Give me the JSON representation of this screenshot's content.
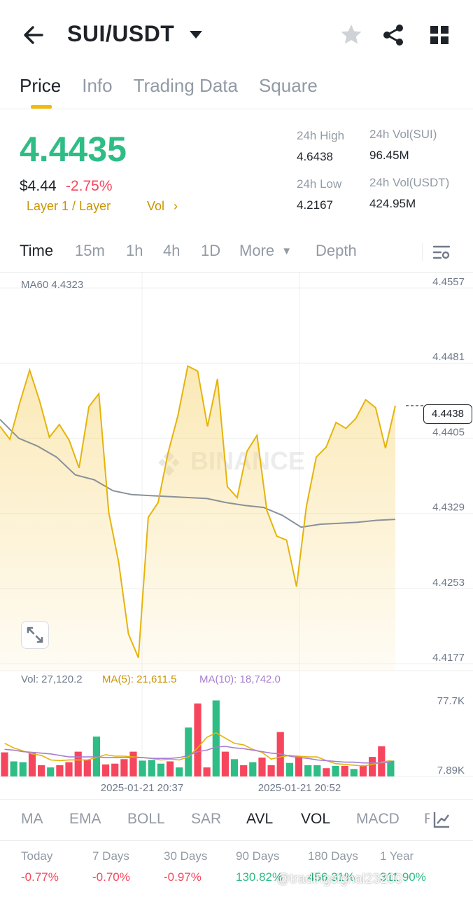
{
  "header": {
    "pair": "SUI/USDT"
  },
  "tabs": [
    {
      "label": "Price",
      "active": true
    },
    {
      "label": "Info",
      "active": false
    },
    {
      "label": "Trading Data",
      "active": false
    },
    {
      "label": "Square",
      "active": false
    }
  ],
  "ticker": {
    "last_price": "4.4435",
    "usd_price": "$4.44",
    "change_pct": "-2.75%",
    "tags": "Layer 1 / Layer",
    "vol_link": "Vol",
    "high_label": "24h High",
    "high_value": "4.6438",
    "low_label": "24h Low",
    "low_value": "4.2167",
    "vol_base_label": "24h Vol(SUI)",
    "vol_base_value": "96.45M",
    "vol_quote_label": "24h Vol(USDT)",
    "vol_quote_value": "424.95M"
  },
  "intervals": {
    "items": [
      "Time",
      "15m",
      "1h",
      "4h",
      "1D",
      "More"
    ],
    "active": "Time",
    "depth": "Depth"
  },
  "chart_data": {
    "type": "line",
    "price_ma_label": "MA60 4.4323",
    "watermark": "BINANCE",
    "y_ticks": [
      "4.4557",
      "4.4481",
      "4.4405",
      "4.4329",
      "4.4253",
      "4.4177"
    ],
    "ylim": [
      4.4177,
      4.4557
    ],
    "current_price": "4.4438",
    "x_ticks": [
      "2025-01-21 20:37",
      "2025-01-21 20:52"
    ],
    "price": [
      4.4417,
      4.4404,
      4.4441,
      4.4474,
      4.4443,
      4.4406,
      4.4419,
      4.4403,
      4.4375,
      4.4437,
      4.445,
      4.433,
      4.428,
      4.4207,
      4.4183,
      4.4325,
      4.434,
      4.439,
      4.4428,
      4.4478,
      4.4473,
      4.4417,
      4.4465,
      4.4356,
      4.4345,
      4.4392,
      4.4408,
      4.4332,
      4.4306,
      4.4302,
      4.4255,
      4.4336,
      4.4386,
      4.4396,
      4.4421,
      4.4415,
      4.4425,
      4.4444,
      4.4436,
      4.4395,
      4.4438
    ],
    "ma60": [
      4.4424,
      4.4405,
      4.4397,
      4.4386,
      4.4368,
      4.4363,
      4.4352,
      4.4348,
      4.4347,
      4.4346,
      4.4345,
      4.4344,
      4.434,
      4.4337,
      4.4335,
      4.4327,
      4.4315,
      4.4318,
      4.4319,
      4.432,
      4.4322,
      4.4323
    ],
    "vol_label": "Vol: 27,120.2",
    "vol_ma5_label": "MA(5): 21,611.5",
    "vol_ma10_label": "MA(10): 18,742.0",
    "vol_ticks": [
      "77.7K",
      "7.89K"
    ],
    "vol_ylim": [
      7.89,
      77.7
    ],
    "volume": [
      32,
      20,
      19,
      31,
      15,
      12,
      15,
      19,
      33,
      22,
      53,
      16,
      17,
      23,
      33,
      21,
      22,
      17,
      20,
      12,
      65,
      97,
      12,
      101,
      33,
      23,
      15,
      19,
      25,
      15,
      59,
      18,
      27,
      15,
      15,
      11,
      14,
      14,
      10,
      15,
      26,
      40,
      21
    ],
    "volume_up": [
      false,
      true,
      true,
      false,
      false,
      true,
      false,
      false,
      false,
      false,
      true,
      false,
      false,
      false,
      false,
      true,
      true,
      true,
      false,
      true,
      true,
      false,
      false,
      true,
      false,
      true,
      false,
      true,
      false,
      false,
      false,
      true,
      false,
      true,
      true,
      false,
      true,
      false,
      true,
      false,
      false,
      false,
      true
    ],
    "vol_ma5": [
      44,
      38,
      34,
      30,
      28,
      22,
      21,
      22,
      22,
      22,
      25,
      29,
      27,
      27,
      26,
      25,
      24,
      22,
      23,
      22,
      26,
      38,
      52,
      58,
      51,
      44,
      42,
      36,
      32,
      23,
      26,
      28,
      27,
      26,
      26,
      21,
      17,
      16,
      15,
      14,
      16,
      19,
      21
    ],
    "vol_ma10": [
      36,
      35,
      33,
      32,
      31,
      30,
      28,
      26,
      26,
      26,
      26,
      25,
      25,
      25,
      25,
      25,
      24,
      24,
      24,
      25,
      28,
      33,
      35,
      39,
      40,
      38,
      37,
      35,
      33,
      31,
      30,
      27,
      25,
      24,
      22,
      21,
      20,
      19,
      19,
      18,
      18,
      18,
      19
    ],
    "colors": {
      "up": "#2ebd85",
      "down": "#f6465d",
      "line": "#e5b40b",
      "ma": "#8a9199",
      "vol_ma5": "#e5b40b",
      "vol_ma10": "#a87fd1"
    }
  },
  "indicators": {
    "items": [
      "MA",
      "EMA",
      "BOLL",
      "SAR",
      "AVL",
      "VOL",
      "MACD",
      "R"
    ],
    "active": [
      "AVL",
      "VOL"
    ]
  },
  "performance": [
    {
      "label": "Today",
      "value": "-0.77%",
      "dir": "neg"
    },
    {
      "label": "7 Days",
      "value": "-0.70%",
      "dir": "neg"
    },
    {
      "label": "30 Days",
      "value": "-0.97%",
      "dir": "neg"
    },
    {
      "label": "90 Days",
      "value": "130.82%",
      "dir": "pos"
    },
    {
      "label": "180 Days",
      "value": "456.31%",
      "dir": "pos"
    },
    {
      "label": "1 Year",
      "value": "311.90%",
      "dir": "pos"
    }
  ],
  "watermark_text": "@tradingsignal23200",
  "icons": {
    "back": "arrow-left-icon",
    "caret": "caret-down-icon",
    "favorite": "star-icon",
    "share": "share-icon",
    "apps": "grid-icon",
    "settings": "chart-settings-icon",
    "expand": "expand-icon",
    "indicator_settings": "chart-indicator-icon"
  }
}
